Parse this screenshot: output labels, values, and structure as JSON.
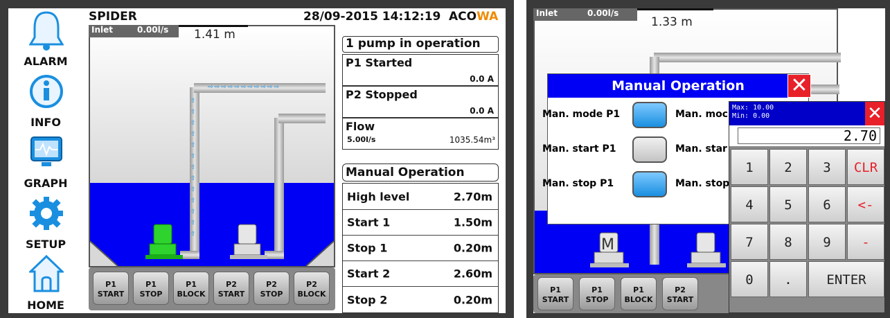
{
  "left": {
    "title": "SPIDER",
    "datetime": "28/09-2015  14:12:19",
    "brand_a": "ACO",
    "brand_b": "WA",
    "sidebar": [
      {
        "label": "ALARM",
        "icon": "bell-icon"
      },
      {
        "label": "INFO",
        "icon": "info-icon"
      },
      {
        "label": "GRAPH",
        "icon": "graph-icon"
      },
      {
        "label": "SETUP",
        "icon": "gear-icon"
      },
      {
        "label": "HOME",
        "icon": "home-icon"
      }
    ],
    "inlet_label": "Inlet",
    "inlet_value": "0.00l/s",
    "level": "1.41 m",
    "buttons": [
      {
        "l1": "P1",
        "l2": "START"
      },
      {
        "l1": "P1",
        "l2": "STOP"
      },
      {
        "l1": "P1",
        "l2": "BLOCK"
      },
      {
        "l1": "P2",
        "l2": "START"
      },
      {
        "l1": "P2",
        "l2": "STOP"
      },
      {
        "l1": "P2",
        "l2": "BLOCK"
      }
    ],
    "status": "1 pump in operation",
    "p1": {
      "label": "P1 Started",
      "value": "0.0  A"
    },
    "p2": {
      "label": "P2 Stopped",
      "value": "0.0  A"
    },
    "flow": {
      "label": "Flow",
      "rate": "5.00l/s",
      "volume": "1035.54m³"
    },
    "manual_header": "Manual Operation",
    "levels": [
      {
        "label": "High level",
        "value": "2.70m"
      },
      {
        "label": "Start 1",
        "value": "1.50m"
      },
      {
        "label": "Stop 1",
        "value": "0.20m"
      },
      {
        "label": "Start 2",
        "value": "2.60m"
      },
      {
        "label": "Stop 2",
        "value": "0.20m"
      }
    ]
  },
  "right": {
    "inlet_label": "Inlet",
    "inlet_value": "0.00l/s",
    "level": "1.33 m",
    "dialog_title": "Manual Operation",
    "rows": [
      {
        "label": "Man. mode P1",
        "label2": "Man. moc"
      },
      {
        "label": "Man. start P1",
        "label2": "Man. star"
      },
      {
        "label": "Man. stop P1",
        "label2": "Man. stop"
      }
    ],
    "buttons": [
      {
        "l1": "P1",
        "l2": "START"
      },
      {
        "l1": "P1",
        "l2": "STOP"
      },
      {
        "l1": "P1",
        "l2": "BLOCK"
      },
      {
        "l1": "P2",
        "l2": "START"
      }
    ],
    "keypad": {
      "max": "Max: 10.00",
      "min": "Min: 0.00",
      "display": "2.70",
      "keys": [
        "1",
        "2",
        "3",
        "CLR",
        "4",
        "5",
        "6",
        "<-",
        "7",
        "8",
        "9",
        "-",
        "0",
        ".",
        "ENTER"
      ]
    }
  }
}
